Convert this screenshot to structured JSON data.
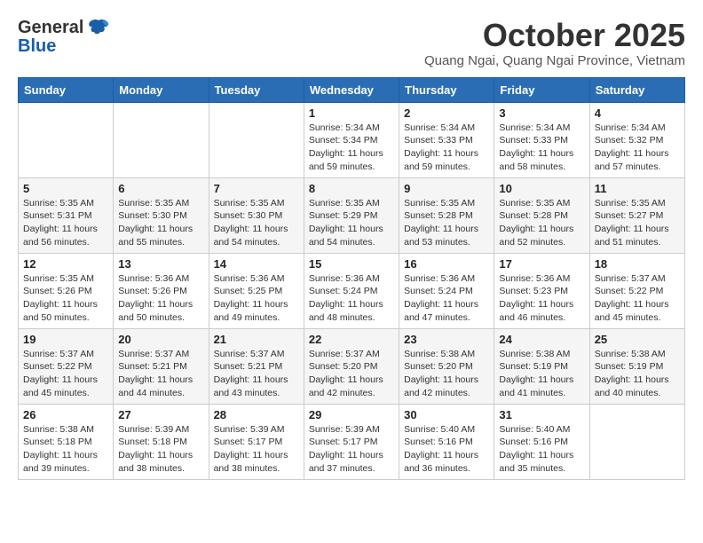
{
  "header": {
    "logo_general": "General",
    "logo_blue": "Blue",
    "month_title": "October 2025",
    "location": "Quang Ngai, Quang Ngai Province, Vietnam"
  },
  "weekdays": [
    "Sunday",
    "Monday",
    "Tuesday",
    "Wednesday",
    "Thursday",
    "Friday",
    "Saturday"
  ],
  "weeks": [
    [
      {
        "day": "",
        "info": ""
      },
      {
        "day": "",
        "info": ""
      },
      {
        "day": "",
        "info": ""
      },
      {
        "day": "1",
        "info": "Sunrise: 5:34 AM\nSunset: 5:34 PM\nDaylight: 11 hours\nand 59 minutes."
      },
      {
        "day": "2",
        "info": "Sunrise: 5:34 AM\nSunset: 5:33 PM\nDaylight: 11 hours\nand 59 minutes."
      },
      {
        "day": "3",
        "info": "Sunrise: 5:34 AM\nSunset: 5:33 PM\nDaylight: 11 hours\nand 58 minutes."
      },
      {
        "day": "4",
        "info": "Sunrise: 5:34 AM\nSunset: 5:32 PM\nDaylight: 11 hours\nand 57 minutes."
      }
    ],
    [
      {
        "day": "5",
        "info": "Sunrise: 5:35 AM\nSunset: 5:31 PM\nDaylight: 11 hours\nand 56 minutes."
      },
      {
        "day": "6",
        "info": "Sunrise: 5:35 AM\nSunset: 5:30 PM\nDaylight: 11 hours\nand 55 minutes."
      },
      {
        "day": "7",
        "info": "Sunrise: 5:35 AM\nSunset: 5:30 PM\nDaylight: 11 hours\nand 54 minutes."
      },
      {
        "day": "8",
        "info": "Sunrise: 5:35 AM\nSunset: 5:29 PM\nDaylight: 11 hours\nand 54 minutes."
      },
      {
        "day": "9",
        "info": "Sunrise: 5:35 AM\nSunset: 5:28 PM\nDaylight: 11 hours\nand 53 minutes."
      },
      {
        "day": "10",
        "info": "Sunrise: 5:35 AM\nSunset: 5:28 PM\nDaylight: 11 hours\nand 52 minutes."
      },
      {
        "day": "11",
        "info": "Sunrise: 5:35 AM\nSunset: 5:27 PM\nDaylight: 11 hours\nand 51 minutes."
      }
    ],
    [
      {
        "day": "12",
        "info": "Sunrise: 5:35 AM\nSunset: 5:26 PM\nDaylight: 11 hours\nand 50 minutes."
      },
      {
        "day": "13",
        "info": "Sunrise: 5:36 AM\nSunset: 5:26 PM\nDaylight: 11 hours\nand 50 minutes."
      },
      {
        "day": "14",
        "info": "Sunrise: 5:36 AM\nSunset: 5:25 PM\nDaylight: 11 hours\nand 49 minutes."
      },
      {
        "day": "15",
        "info": "Sunrise: 5:36 AM\nSunset: 5:24 PM\nDaylight: 11 hours\nand 48 minutes."
      },
      {
        "day": "16",
        "info": "Sunrise: 5:36 AM\nSunset: 5:24 PM\nDaylight: 11 hours\nand 47 minutes."
      },
      {
        "day": "17",
        "info": "Sunrise: 5:36 AM\nSunset: 5:23 PM\nDaylight: 11 hours\nand 46 minutes."
      },
      {
        "day": "18",
        "info": "Sunrise: 5:37 AM\nSunset: 5:22 PM\nDaylight: 11 hours\nand 45 minutes."
      }
    ],
    [
      {
        "day": "19",
        "info": "Sunrise: 5:37 AM\nSunset: 5:22 PM\nDaylight: 11 hours\nand 45 minutes."
      },
      {
        "day": "20",
        "info": "Sunrise: 5:37 AM\nSunset: 5:21 PM\nDaylight: 11 hours\nand 44 minutes."
      },
      {
        "day": "21",
        "info": "Sunrise: 5:37 AM\nSunset: 5:21 PM\nDaylight: 11 hours\nand 43 minutes."
      },
      {
        "day": "22",
        "info": "Sunrise: 5:37 AM\nSunset: 5:20 PM\nDaylight: 11 hours\nand 42 minutes."
      },
      {
        "day": "23",
        "info": "Sunrise: 5:38 AM\nSunset: 5:20 PM\nDaylight: 11 hours\nand 42 minutes."
      },
      {
        "day": "24",
        "info": "Sunrise: 5:38 AM\nSunset: 5:19 PM\nDaylight: 11 hours\nand 41 minutes."
      },
      {
        "day": "25",
        "info": "Sunrise: 5:38 AM\nSunset: 5:19 PM\nDaylight: 11 hours\nand 40 minutes."
      }
    ],
    [
      {
        "day": "26",
        "info": "Sunrise: 5:38 AM\nSunset: 5:18 PM\nDaylight: 11 hours\nand 39 minutes."
      },
      {
        "day": "27",
        "info": "Sunrise: 5:39 AM\nSunset: 5:18 PM\nDaylight: 11 hours\nand 38 minutes."
      },
      {
        "day": "28",
        "info": "Sunrise: 5:39 AM\nSunset: 5:17 PM\nDaylight: 11 hours\nand 38 minutes."
      },
      {
        "day": "29",
        "info": "Sunrise: 5:39 AM\nSunset: 5:17 PM\nDaylight: 11 hours\nand 37 minutes."
      },
      {
        "day": "30",
        "info": "Sunrise: 5:40 AM\nSunset: 5:16 PM\nDaylight: 11 hours\nand 36 minutes."
      },
      {
        "day": "31",
        "info": "Sunrise: 5:40 AM\nSunset: 5:16 PM\nDaylight: 11 hours\nand 35 minutes."
      },
      {
        "day": "",
        "info": ""
      }
    ]
  ]
}
